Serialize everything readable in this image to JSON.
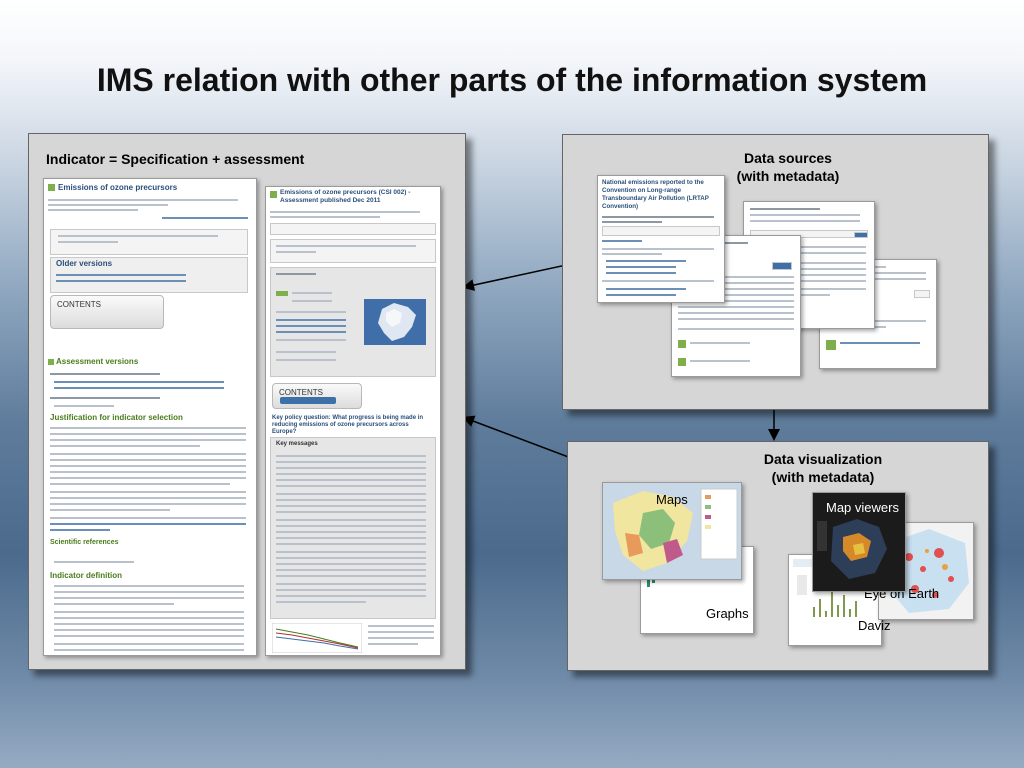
{
  "slide": {
    "title": "IMS relation with other parts of the  information system"
  },
  "indicator_panel": {
    "label": "Indicator = Specification + assessment",
    "left_page": {
      "title": "Emissions of ozone precursors",
      "older_versions": "Older versions",
      "contents": "CONTENTS",
      "assessment_versions": "Assessment versions",
      "justification": "Justification for indicator selection",
      "scientific_refs": "Scientific references",
      "definition": "Indicator definition"
    },
    "right_page": {
      "title": "Emissions of ozone precursors (CSI 002) - Assessment published Dec 2011",
      "contents": "CONTENTS",
      "policy_question": "Key policy question: What progress is being made in reducing emissions of ozone precursors across Europe?",
      "key_messages": "Key messages"
    }
  },
  "data_sources_panel": {
    "label_line1": "Data sources",
    "label_line2": "(with metadata)",
    "front_doc_title": "National emissions reported to the Convention on Long-range Transboundary Air Pollution (LRTAP Convention)"
  },
  "visualization_panel": {
    "label_line1": "Data visualization",
    "label_line2": "(with metadata)",
    "maps": "Maps",
    "graphs": "Graphs",
    "map_viewers": "Map viewers",
    "eye_on_earth": "Eye on Earth",
    "daviz": "Daviz"
  },
  "colors": {
    "accent_green": "#7fae4c",
    "link_blue": "#2a4f7a",
    "arrow": "#000000"
  },
  "icons": [
    "arrow-left-icon",
    "arrow-down-icon",
    "indicator-icon"
  ]
}
